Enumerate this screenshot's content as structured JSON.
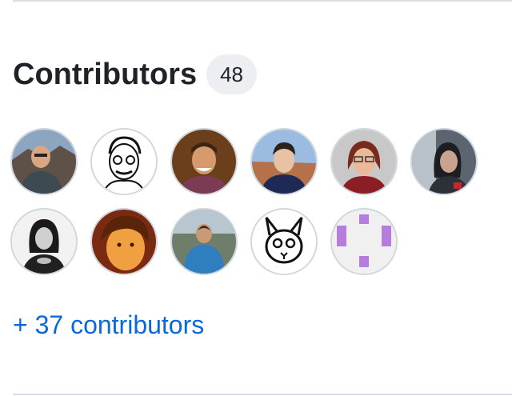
{
  "section": {
    "title": "Contributors",
    "count": "48",
    "more_link": "+ 37 contributors"
  },
  "contributors": [
    {
      "avatar": "photo-man-mountains"
    },
    {
      "avatar": "sketch-man-glasses"
    },
    {
      "avatar": "photo-man-smiling"
    },
    {
      "avatar": "photo-man-canyon"
    },
    {
      "avatar": "photo-woman-glasses"
    },
    {
      "avatar": "photo-woman-dark"
    },
    {
      "avatar": "photo-woman-bw"
    },
    {
      "avatar": "photo-person-orange"
    },
    {
      "avatar": "photo-man-outdoor"
    },
    {
      "avatar": "rabbit-drawing"
    },
    {
      "avatar": "identicon-purple"
    }
  ],
  "colors": {
    "link": "#0969da",
    "identicon": "#b57edc",
    "counter_bg": "#eceef1"
  }
}
